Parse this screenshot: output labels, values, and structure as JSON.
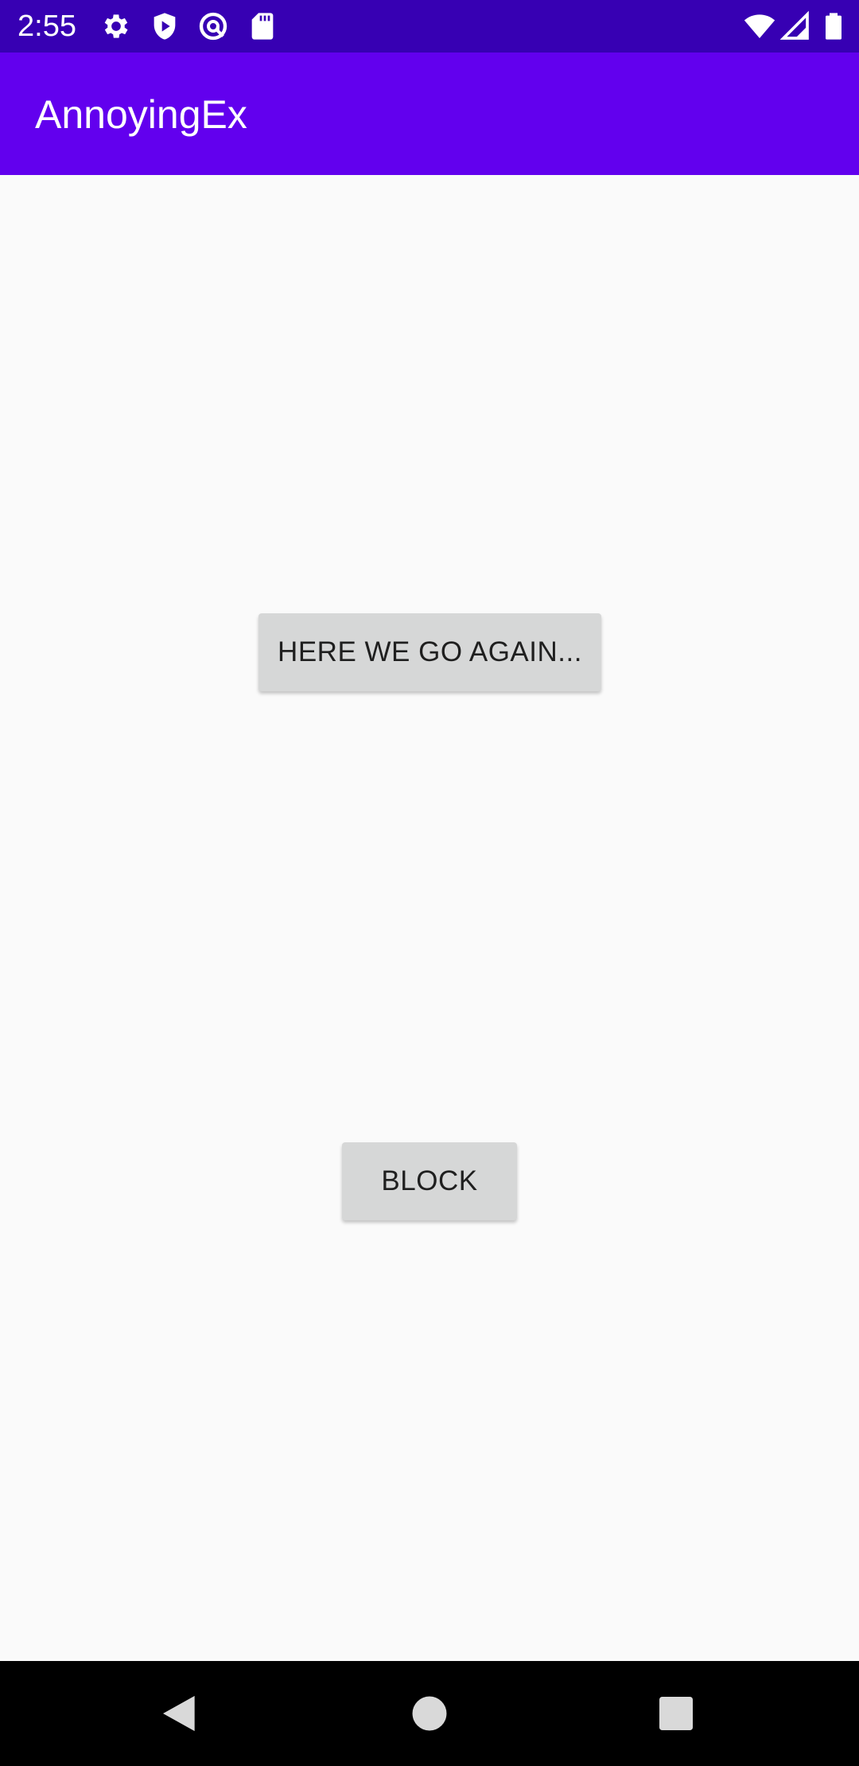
{
  "status_bar": {
    "time": "2:55",
    "left_icons": [
      "settings-icon",
      "shield-play-icon",
      "at-sign-icon",
      "sd-card-icon"
    ],
    "right_icons": [
      "wifi-icon",
      "cell-signal-icon",
      "battery-icon"
    ],
    "color": "#3700b3"
  },
  "app_bar": {
    "title": "AnnoyingEx",
    "color": "#6200ee"
  },
  "main": {
    "again_button_label": "HERE WE GO AGAIN...",
    "block_button_label": "BLOCK",
    "background": "#fafafa",
    "button_color": "#d6d7d7"
  },
  "nav_bar": {
    "buttons": [
      "back-icon",
      "home-icon",
      "recents-icon"
    ]
  }
}
